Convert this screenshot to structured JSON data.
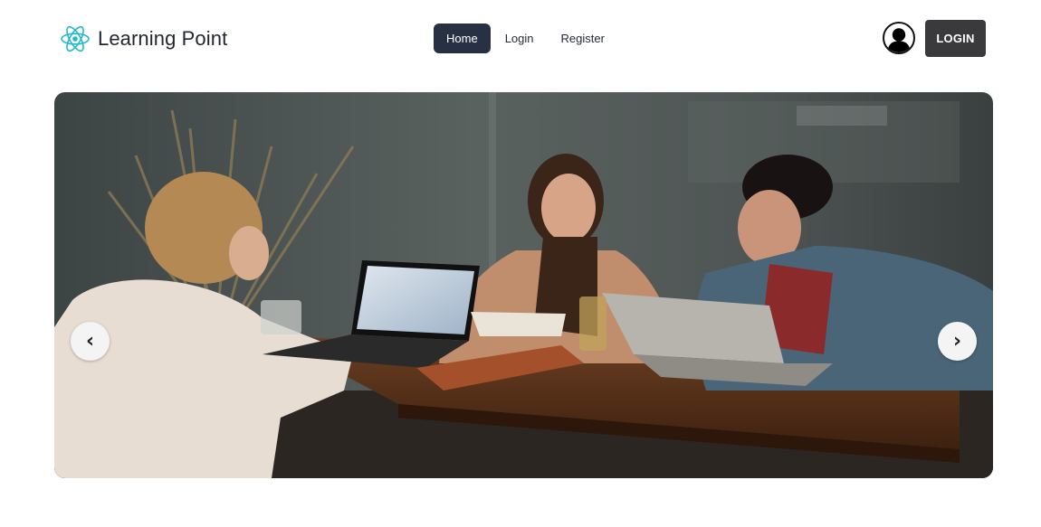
{
  "navbar": {
    "brand": {
      "text": "Learning Point",
      "logo_icon": "react-atom-icon",
      "logo_color": "#22b8cf"
    },
    "links": [
      {
        "label": "Home",
        "active": true
      },
      {
        "label": "Login",
        "active": false
      },
      {
        "label": "Register",
        "active": false
      }
    ],
    "avatar_icon": "user-silhouette-icon",
    "login_button": "LOGIN"
  },
  "carousel": {
    "slide_image": "photo-three-people-laughing-at-cafe-table-with-laptops",
    "prev_label": "‹",
    "next_label": "›",
    "prev_icon": "chevron-left-icon",
    "next_icon": "chevron-right-icon"
  },
  "colors": {
    "nav_active_bg": "#283044",
    "login_bg": "#3a3a3c",
    "text_dark": "#1f2937"
  }
}
